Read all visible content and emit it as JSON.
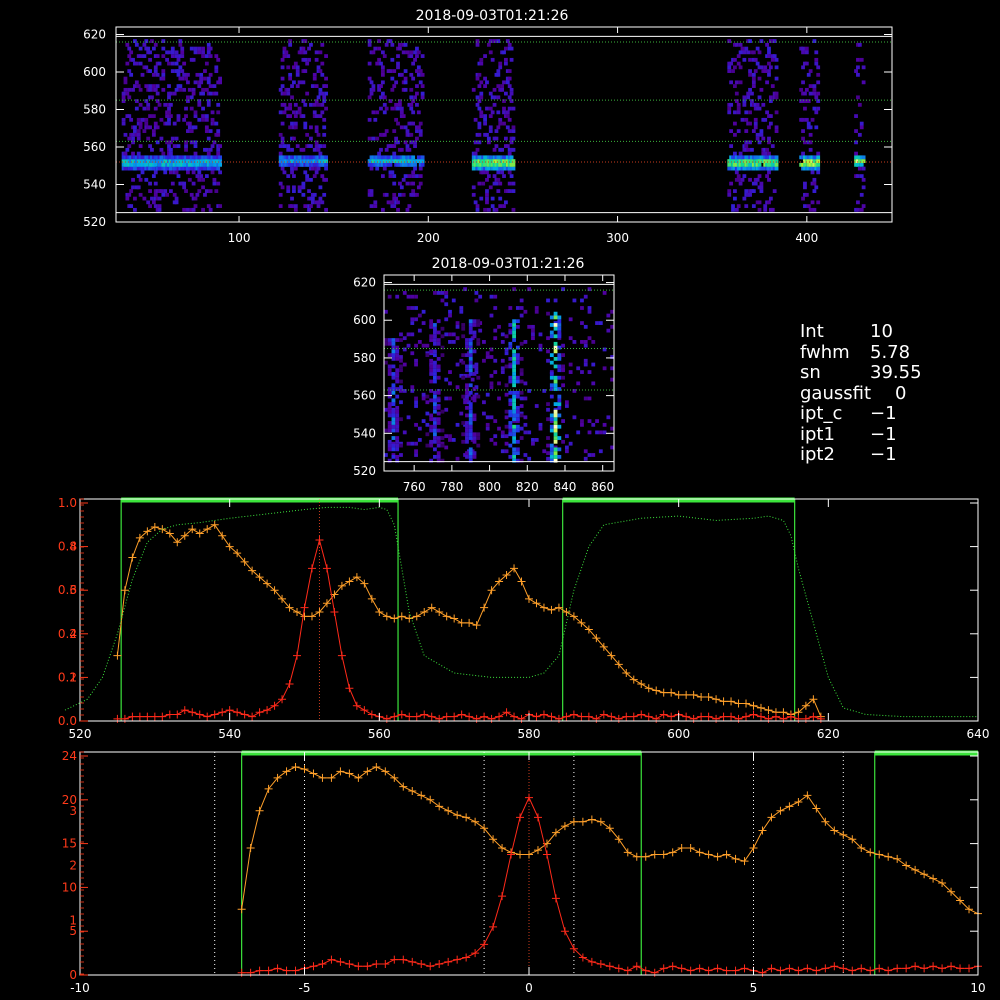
{
  "timestamp_top": "2018-09-03T01:21:26",
  "timestamp_mid": "2018-09-03T01:21:26",
  "info": [
    {
      "key": "Int",
      "value": "10"
    },
    {
      "key": "fwhm",
      "value": "5.78"
    },
    {
      "key": "sn",
      "value": "39.55"
    },
    {
      "key": "gaussfit",
      "value": "0"
    },
    {
      "key": "ipt_c",
      "value": "−1"
    },
    {
      "key": "ipt1",
      "value": "−1"
    },
    {
      "key": "ipt2",
      "value": "−1"
    }
  ],
  "chart_data": [
    {
      "type": "heatmap",
      "title": "2018-09-03T01:21:26",
      "xlim": [
        35,
        445
      ],
      "ylim": [
        520,
        624
      ],
      "xticks": [
        100,
        200,
        300,
        400
      ],
      "yticks": [
        520,
        540,
        560,
        580,
        600,
        620
      ],
      "hlines": [
        {
          "y": 552,
          "color": "#c83c1e"
        },
        {
          "y": 525,
          "color": "#ffffff"
        },
        {
          "y": 619,
          "color": "#ffffff"
        },
        {
          "y": 563,
          "color": "#3cb43c"
        },
        {
          "y": 585,
          "color": "#3cb43c"
        },
        {
          "y": 616,
          "color": "#3cb43c"
        }
      ],
      "bands": [
        {
          "x0": 38,
          "x1": 90,
          "center": 551,
          "intensity": 0.6
        },
        {
          "x0": 121,
          "x1": 146,
          "center": 552,
          "intensity": 0.5
        },
        {
          "x0": 168,
          "x1": 197,
          "center": 552,
          "intensity": 0.55
        },
        {
          "x0": 223,
          "x1": 245,
          "center": 551,
          "intensity": 0.85
        },
        {
          "x0": 358,
          "x1": 384,
          "center": 551,
          "intensity": 0.8
        },
        {
          "x0": 396,
          "x1": 406,
          "center": 551,
          "intensity": 0.9
        },
        {
          "x0": 425,
          "x1": 430,
          "center": 552,
          "intensity": 0.8
        }
      ]
    },
    {
      "type": "heatmap",
      "title": "2018-09-03T01:21:26",
      "xlim": [
        744,
        866
      ],
      "ylim": [
        520,
        624
      ],
      "xticks": [
        760,
        780,
        800,
        820,
        840,
        860
      ],
      "yticks": [
        520,
        540,
        560,
        580,
        600,
        620
      ],
      "hlines": [
        {
          "y": 525,
          "color": "#ffffff"
        },
        {
          "y": 619,
          "color": "#ffffff"
        },
        {
          "y": 563,
          "color": "#3cb43c"
        },
        {
          "y": 585,
          "color": "#3cb43c"
        },
        {
          "y": 616,
          "color": "#3cb43c"
        }
      ],
      "streaks": [
        {
          "x": 748,
          "y0": 525,
          "y1": 590,
          "intensity": 0.5
        },
        {
          "x": 770,
          "y0": 525,
          "y1": 600,
          "intensity": 0.45
        },
        {
          "x": 789,
          "y0": 525,
          "y1": 600,
          "intensity": 0.5
        },
        {
          "x": 812,
          "y0": 525,
          "y1": 600,
          "intensity": 0.7
        },
        {
          "x": 834,
          "y0": 525,
          "y1": 605,
          "intensity": 0.95
        }
      ]
    },
    {
      "type": "line",
      "xlim": [
        520,
        640
      ],
      "xticks": [
        520,
        540,
        560,
        580,
        600,
        620,
        640
      ],
      "yticks_left": [
        "0.0",
        "0.2",
        "0.4",
        "0.6",
        "0.8",
        "1.0"
      ],
      "yticks_left2": [
        "1",
        "2",
        "3",
        "4"
      ],
      "series": [
        {
          "color": "#ffa02a",
          "x": [
            525,
            526,
            527,
            528,
            529,
            530,
            531,
            532,
            533,
            534,
            535,
            536,
            537,
            538,
            539,
            540,
            541,
            542,
            543,
            544,
            545,
            546,
            547,
            548,
            549,
            550,
            551,
            552,
            553,
            554,
            555,
            556,
            557,
            558,
            559,
            560,
            561,
            562,
            563,
            564,
            565,
            566,
            567,
            568,
            569,
            570,
            571,
            572,
            573,
            574,
            575,
            576,
            577,
            578,
            579,
            580,
            581,
            582,
            583,
            584,
            585,
            586,
            587,
            588,
            589,
            590,
            591,
            592,
            593,
            594,
            595,
            596,
            597,
            598,
            599,
            600,
            601,
            602,
            603,
            604,
            605,
            606,
            607,
            608,
            609,
            610,
            611,
            612,
            613,
            614,
            615,
            616,
            617,
            618,
            619
          ],
          "y": [
            0.3,
            0.6,
            0.75,
            0.84,
            0.87,
            0.89,
            0.88,
            0.86,
            0.82,
            0.85,
            0.88,
            0.86,
            0.88,
            0.9,
            0.85,
            0.8,
            0.77,
            0.73,
            0.69,
            0.66,
            0.63,
            0.6,
            0.56,
            0.52,
            0.5,
            0.48,
            0.48,
            0.5,
            0.54,
            0.58,
            0.62,
            0.64,
            0.66,
            0.63,
            0.56,
            0.5,
            0.48,
            0.47,
            0.48,
            0.47,
            0.48,
            0.5,
            0.52,
            0.5,
            0.48,
            0.47,
            0.45,
            0.45,
            0.44,
            0.52,
            0.6,
            0.64,
            0.67,
            0.7,
            0.64,
            0.56,
            0.54,
            0.52,
            0.51,
            0.52,
            0.5,
            0.48,
            0.45,
            0.42,
            0.38,
            0.34,
            0.3,
            0.26,
            0.22,
            0.19,
            0.17,
            0.15,
            0.14,
            0.13,
            0.13,
            0.12,
            0.12,
            0.12,
            0.11,
            0.11,
            0.1,
            0.09,
            0.09,
            0.08,
            0.08,
            0.07,
            0.06,
            0.05,
            0.04,
            0.04,
            0.03,
            0.04,
            0.07,
            0.1,
            0.02
          ]
        },
        {
          "color": "#ff2a1a",
          "x": [
            525,
            526,
            527,
            528,
            529,
            530,
            531,
            532,
            533,
            534,
            535,
            536,
            537,
            538,
            539,
            540,
            541,
            542,
            543,
            544,
            545,
            546,
            547,
            548,
            549,
            550,
            551,
            552,
            553,
            554,
            555,
            556,
            557,
            558,
            559,
            560,
            561,
            562,
            563,
            564,
            565,
            566,
            567,
            568,
            569,
            570,
            571,
            572,
            573,
            574,
            575,
            576,
            577,
            578,
            579,
            580,
            581,
            582,
            583,
            584,
            585,
            586,
            587,
            588,
            589,
            590,
            591,
            592,
            593,
            594,
            595,
            596,
            597,
            598,
            599,
            600,
            601,
            602,
            603,
            604,
            605,
            606,
            607,
            608,
            609,
            610,
            611,
            612,
            613,
            614,
            615,
            616,
            617,
            618,
            619
          ],
          "y": [
            0.01,
            0.01,
            0.02,
            0.02,
            0.02,
            0.02,
            0.02,
            0.03,
            0.03,
            0.05,
            0.04,
            0.03,
            0.02,
            0.03,
            0.04,
            0.05,
            0.04,
            0.03,
            0.02,
            0.04,
            0.05,
            0.07,
            0.1,
            0.17,
            0.3,
            0.52,
            0.7,
            0.83,
            0.7,
            0.5,
            0.3,
            0.15,
            0.07,
            0.05,
            0.03,
            0.02,
            0.01,
            0.02,
            0.03,
            0.02,
            0.02,
            0.03,
            0.02,
            0.01,
            0.02,
            0.02,
            0.03,
            0.02,
            0.01,
            0.02,
            0.01,
            0.02,
            0.04,
            0.02,
            0.01,
            0.03,
            0.02,
            0.03,
            0.02,
            0.01,
            0.02,
            0.03,
            0.02,
            0.02,
            0.01,
            0.03,
            0.02,
            0.01,
            0.02,
            0.02,
            0.03,
            0.02,
            0.01,
            0.03,
            0.02,
            0.03,
            0.02,
            0.01,
            0.02,
            0.02,
            0.01,
            0.02,
            0.02,
            0.01,
            0.02,
            0.03,
            0.02,
            0.01,
            0.02,
            0.01,
            0.02,
            0.01,
            0.01,
            0.02,
            0.01
          ]
        },
        {
          "color": "#3ce43c",
          "dotted": true,
          "x": [
            518,
            521,
            523,
            525,
            527,
            529,
            531,
            533,
            536,
            540,
            545,
            550,
            553,
            556,
            558,
            560,
            561,
            562,
            563,
            564,
            566,
            570,
            575,
            580,
            582,
            584,
            585,
            586,
            588,
            590,
            595,
            600,
            605,
            610,
            612,
            614,
            615,
            616,
            618,
            620,
            622,
            625,
            630,
            635,
            640
          ],
          "y": [
            0.05,
            0.1,
            0.2,
            0.4,
            0.65,
            0.82,
            0.88,
            0.9,
            0.91,
            0.93,
            0.95,
            0.97,
            0.98,
            0.98,
            0.97,
            0.98,
            0.97,
            0.9,
            0.7,
            0.5,
            0.3,
            0.22,
            0.2,
            0.2,
            0.22,
            0.3,
            0.45,
            0.6,
            0.8,
            0.9,
            0.93,
            0.94,
            0.92,
            0.93,
            0.94,
            0.92,
            0.85,
            0.7,
            0.45,
            0.2,
            0.06,
            0.03,
            0.02,
            0.02,
            0.02
          ]
        }
      ],
      "filter_bands": [
        [
          525.5,
          562.5
        ],
        [
          584.5,
          615.5
        ]
      ],
      "center_line": 552
    },
    {
      "type": "line",
      "xlim": [
        -10,
        10
      ],
      "xticks": [
        -10,
        -5,
        0,
        5,
        10
      ],
      "yticks_left": [
        "0",
        "5",
        "10",
        "15",
        "20",
        "24"
      ],
      "yticks_left2": [
        "1",
        "2",
        "3"
      ],
      "series": [
        {
          "color": "#ffa02a",
          "x": [
            -6.4,
            -6.2,
            -6.0,
            -5.8,
            -5.6,
            -5.4,
            -5.2,
            -5.0,
            -4.8,
            -4.6,
            -4.4,
            -4.2,
            -4.0,
            -3.8,
            -3.6,
            -3.4,
            -3.2,
            -3.0,
            -2.8,
            -2.6,
            -2.4,
            -2.2,
            -2.0,
            -1.8,
            -1.6,
            -1.4,
            -1.2,
            -1.0,
            -0.8,
            -0.6,
            -0.4,
            -0.2,
            0.0,
            0.2,
            0.4,
            0.6,
            0.8,
            1.0,
            1.2,
            1.4,
            1.6,
            1.8,
            2.0,
            2.2,
            2.4,
            2.6,
            2.8,
            3.0,
            3.2,
            3.4,
            3.6,
            3.8,
            4.0,
            4.2,
            4.4,
            4.6,
            4.8,
            5.0,
            5.2,
            5.4,
            5.6,
            5.8,
            6.0,
            6.2,
            6.4,
            6.6,
            6.8,
            7.0,
            7.2,
            7.4,
            7.6,
            7.8,
            8.0,
            8.2,
            8.4,
            8.6,
            8.8,
            9.0,
            9.2,
            9.4,
            9.6,
            9.8,
            10.0
          ],
          "y": [
            0.3,
            0.58,
            0.75,
            0.85,
            0.9,
            0.93,
            0.95,
            0.94,
            0.92,
            0.9,
            0.9,
            0.93,
            0.92,
            0.9,
            0.93,
            0.95,
            0.93,
            0.9,
            0.86,
            0.84,
            0.82,
            0.8,
            0.77,
            0.75,
            0.73,
            0.72,
            0.7,
            0.67,
            0.62,
            0.58,
            0.56,
            0.55,
            0.55,
            0.57,
            0.6,
            0.65,
            0.68,
            0.7,
            0.7,
            0.71,
            0.7,
            0.67,
            0.62,
            0.56,
            0.54,
            0.54,
            0.55,
            0.55,
            0.56,
            0.58,
            0.58,
            0.56,
            0.55,
            0.54,
            0.55,
            0.53,
            0.52,
            0.58,
            0.66,
            0.72,
            0.75,
            0.77,
            0.79,
            0.82,
            0.76,
            0.7,
            0.66,
            0.64,
            0.62,
            0.58,
            0.56,
            0.55,
            0.54,
            0.53,
            0.5,
            0.48,
            0.46,
            0.44,
            0.42,
            0.38,
            0.34,
            0.3,
            0.28
          ]
        },
        {
          "color": "#ff2a1a",
          "x": [
            -6.4,
            -6.2,
            -6.0,
            -5.8,
            -5.6,
            -5.4,
            -5.2,
            -5.0,
            -4.8,
            -4.6,
            -4.4,
            -4.2,
            -4.0,
            -3.8,
            -3.6,
            -3.4,
            -3.2,
            -3.0,
            -2.8,
            -2.6,
            -2.4,
            -2.2,
            -2.0,
            -1.8,
            -1.6,
            -1.4,
            -1.2,
            -1.0,
            -0.8,
            -0.6,
            -0.4,
            -0.2,
            0.0,
            0.2,
            0.4,
            0.6,
            0.8,
            1.0,
            1.2,
            1.4,
            1.6,
            1.8,
            2.0,
            2.2,
            2.4,
            2.6,
            2.8,
            3.0,
            3.2,
            3.4,
            3.6,
            3.8,
            4.0,
            4.2,
            4.4,
            4.6,
            4.8,
            5.0,
            5.2,
            5.4,
            5.6,
            5.8,
            6.0,
            6.2,
            6.4,
            6.6,
            6.8,
            7.0,
            7.2,
            7.4,
            7.6,
            7.8,
            8.0,
            8.2,
            8.4,
            8.6,
            8.8,
            9.0,
            9.2,
            9.4,
            9.6,
            9.8,
            10.0
          ],
          "y": [
            0.01,
            0.01,
            0.02,
            0.02,
            0.03,
            0.02,
            0.02,
            0.03,
            0.04,
            0.05,
            0.07,
            0.06,
            0.05,
            0.04,
            0.04,
            0.05,
            0.05,
            0.07,
            0.07,
            0.06,
            0.05,
            0.04,
            0.05,
            0.06,
            0.07,
            0.08,
            0.1,
            0.14,
            0.22,
            0.36,
            0.55,
            0.72,
            0.81,
            0.72,
            0.55,
            0.35,
            0.2,
            0.12,
            0.08,
            0.06,
            0.05,
            0.04,
            0.03,
            0.02,
            0.04,
            0.02,
            0.01,
            0.03,
            0.04,
            0.03,
            0.02,
            0.03,
            0.02,
            0.03,
            0.02,
            0.02,
            0.03,
            0.02,
            0.01,
            0.03,
            0.02,
            0.03,
            0.02,
            0.03,
            0.02,
            0.03,
            0.04,
            0.03,
            0.02,
            0.03,
            0.02,
            0.03,
            0.02,
            0.03,
            0.03,
            0.04,
            0.03,
            0.04,
            0.03,
            0.04,
            0.03,
            0.03,
            0.04
          ]
        }
      ],
      "filter_bands": [
        [
          -6.4,
          2.5
        ],
        [
          7.7,
          10
        ]
      ],
      "vlines_white": [
        -7,
        -5,
        -1,
        1,
        5,
        7
      ],
      "center_line": 0
    }
  ]
}
